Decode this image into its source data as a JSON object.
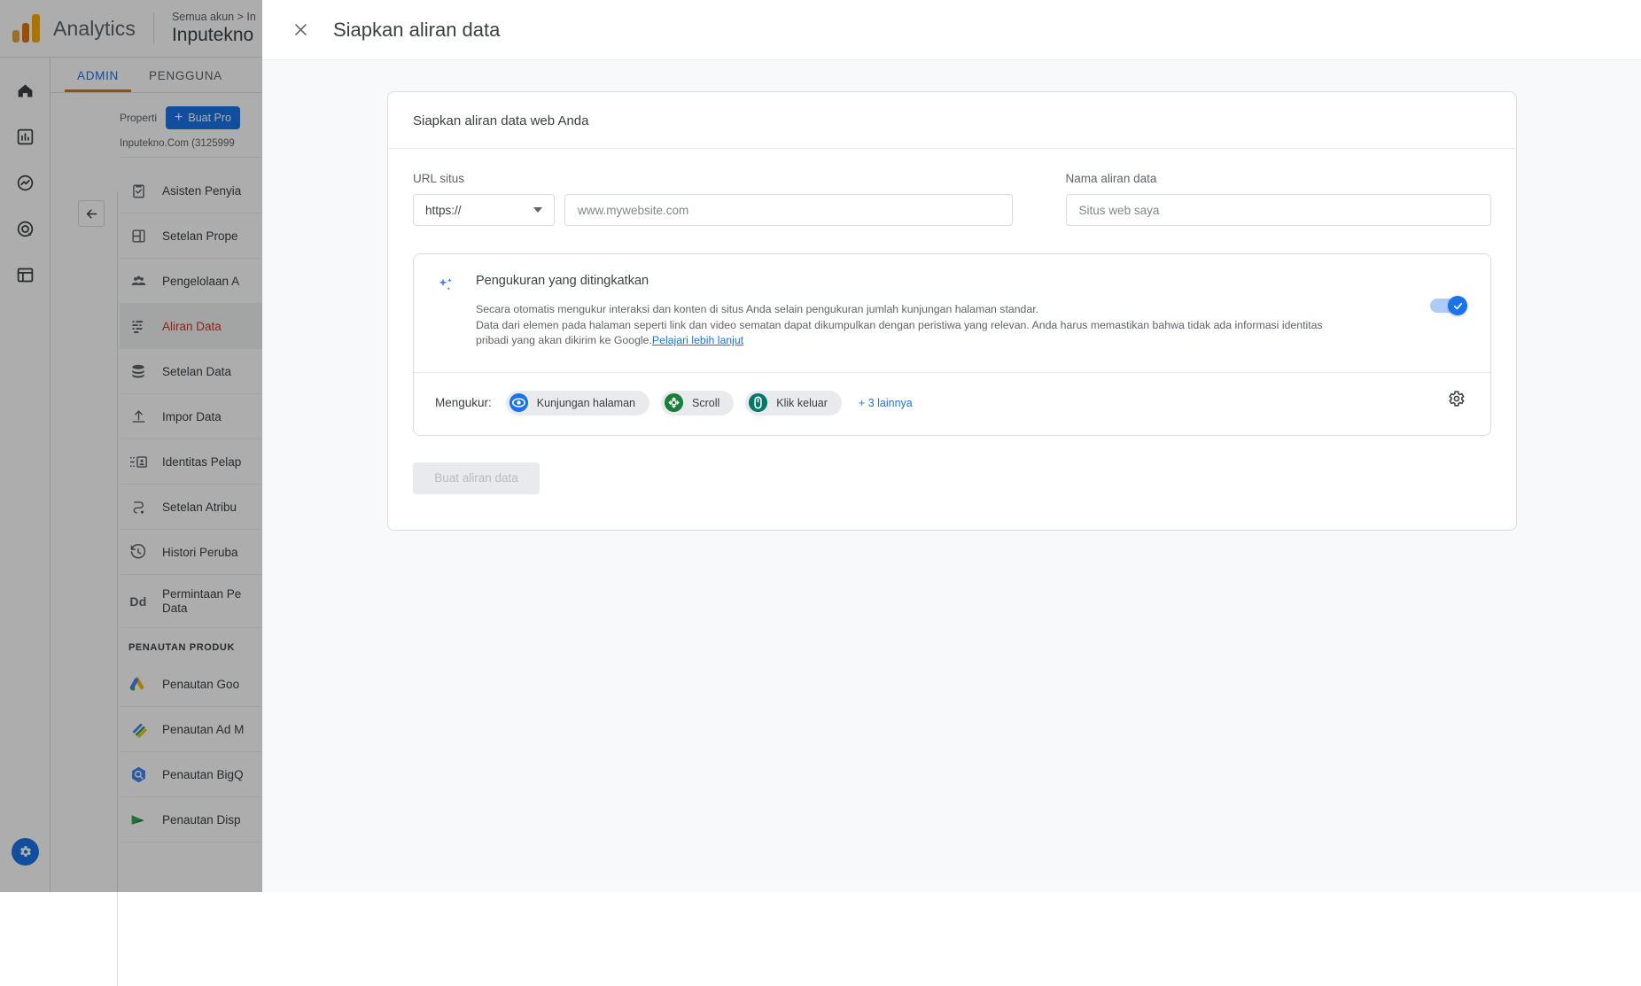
{
  "topbar": {
    "brand": "Analytics",
    "breadcrumb": "Semua akun > In",
    "account_name": "Inputekno",
    "logo_icon": "google-analytics-logo"
  },
  "rail": {
    "items": [
      {
        "icon": "home-icon",
        "name": "home"
      },
      {
        "icon": "reports-bar-chart-icon",
        "name": "reports"
      },
      {
        "icon": "explore-icon",
        "name": "explore"
      },
      {
        "icon": "advertising-target-icon",
        "name": "advertising"
      },
      {
        "icon": "library-table-icon",
        "name": "library"
      }
    ],
    "settings_icon": "gear-icon"
  },
  "tabs": [
    {
      "label": "ADMIN",
      "active": true
    },
    {
      "label": "PENGGUNA",
      "active": false
    }
  ],
  "properties_panel": {
    "label": "Properti",
    "create_button": "Buat Pro",
    "create_icon": "plus-icon",
    "property_name": "Inputekno.Com (3125999",
    "collapse_icon": "arrow-left-icon",
    "section_heading": "PENAUTAN PRODUK",
    "items": [
      {
        "label": "Asisten Penyia",
        "icon": "clipboard-check-icon",
        "active": false
      },
      {
        "label": "Setelan Prope",
        "icon": "layout-icon",
        "active": false
      },
      {
        "label": "Pengelolaan A",
        "icon": "people-icon",
        "active": false
      },
      {
        "label": "Aliran Data",
        "icon": "data-streams-icon",
        "active": true
      },
      {
        "label": "Setelan Data",
        "icon": "database-icon",
        "active": false
      },
      {
        "label": "Impor Data",
        "icon": "upload-icon",
        "active": false
      },
      {
        "label": "Identitas Pelap",
        "icon": "reporting-identity-icon",
        "active": false
      },
      {
        "label": "Setelan Atribu",
        "icon": "attribution-icon",
        "active": false
      },
      {
        "label": "Histori Peruba",
        "icon": "history-clock-icon",
        "active": false
      },
      {
        "label": "Permintaan Pe\nData",
        "icon": "dd-text-icon",
        "active": false
      }
    ],
    "linking_items": [
      {
        "label": "Penautan Goo",
        "icon": "google-ads-icon"
      },
      {
        "label": "Penautan Ad M",
        "icon": "ad-manager-icon"
      },
      {
        "label": "Penautan BigQ",
        "icon": "bigquery-icon"
      },
      {
        "label": "Penautan Disp",
        "icon": "display-video-icon"
      }
    ]
  },
  "modal": {
    "title": "Siapkan aliran data",
    "close_icon": "close-x-icon",
    "card_title": "Siapkan aliran data web Anda",
    "url_field": {
      "label": "URL situs",
      "scheme_value": "https://",
      "scheme_caret_icon": "chevron-down-icon",
      "placeholder": "www.mywebsite.com",
      "value": ""
    },
    "name_field": {
      "label": "Nama aliran data",
      "placeholder": "Situs web saya",
      "value": ""
    },
    "enhanced_measurement": {
      "spark_icon": "sparkle-icon",
      "title": "Pengukuran yang ditingkatkan",
      "description_line1": "Secara otomatis mengukur interaksi dan konten di situs Anda selain pengukuran jumlah kunjungan halaman standar.",
      "description_line2": "Data dari elemen pada halaman seperti link dan video sematan dapat dikumpulkan dengan peristiwa yang relevan. Anda harus memastikan bahwa tidak ada informasi identitas",
      "description_line3": "pribadi yang akan dikirim ke Google.",
      "learn_more": "Pelajari lebih lanjut",
      "toggle_on": true,
      "toggle_icon": "check-icon",
      "measuring_label": "Mengukur:",
      "chips": [
        {
          "label": "Kunjungan halaman",
          "icon": "eye-icon",
          "color": "#1a73e8"
        },
        {
          "label": "Scroll",
          "icon": "scroll-target-icon",
          "color": "#188038"
        },
        {
          "label": "Klik keluar",
          "icon": "outbound-click-icon",
          "color": "#00796b"
        }
      ],
      "more_link": "+ 3 lainnya",
      "settings_icon": "gear-icon"
    },
    "submit_button": "Buat aliran data"
  },
  "colors": {
    "accent_blue": "#1a73e8",
    "brand_orange": "#e37400",
    "active_red": "#d93025",
    "modal_bg": "#f8f9fa"
  }
}
